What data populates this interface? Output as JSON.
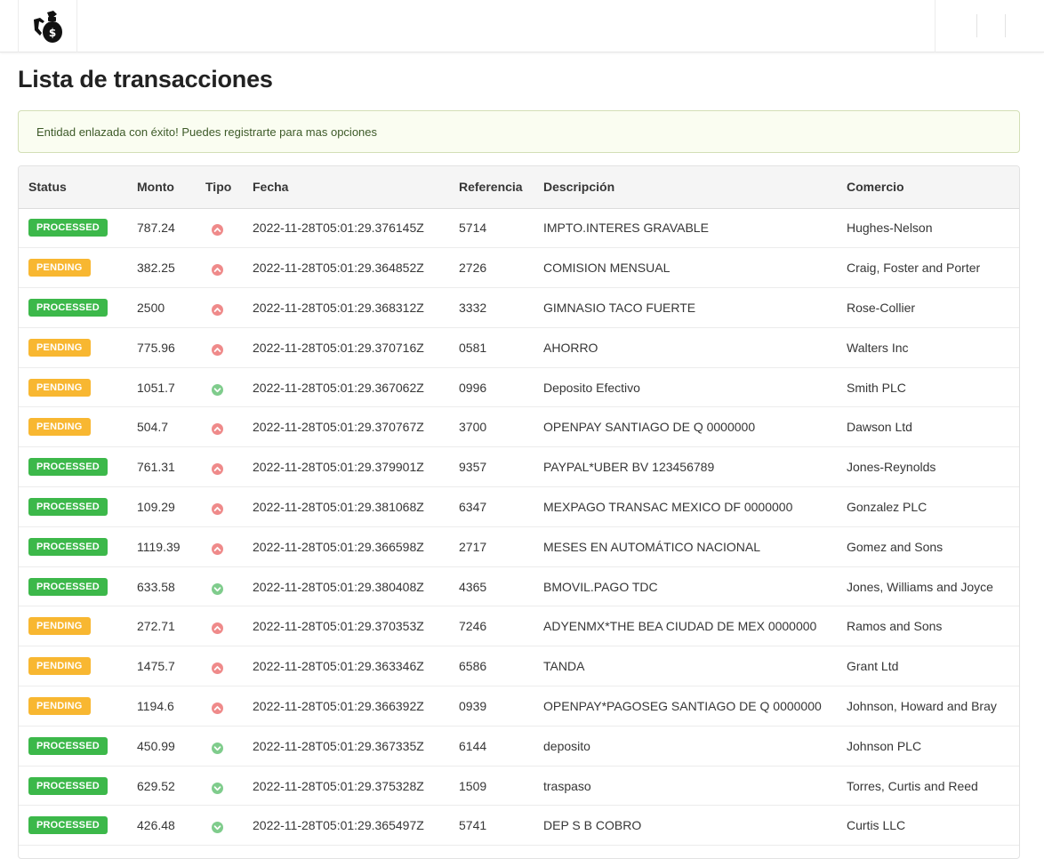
{
  "page": {
    "title": "Lista de transacciones"
  },
  "alert": {
    "text": "Entidad enlazada con éxito! Puedes registrarte para mas opciones"
  },
  "header": {
    "logo_icon": "money-bag-hand-icon"
  },
  "colors": {
    "processed": "#3cb84a",
    "pending": "#f8b731",
    "up_arrow": "#ef8a8a",
    "down_arrow": "#7fcc8c"
  },
  "table": {
    "columns": [
      "Status",
      "Monto",
      "Tipo",
      "Fecha",
      "Referencia",
      "Descripción",
      "Comercio"
    ],
    "rows": [
      {
        "status": "PROCESSED",
        "monto": "787.24",
        "tipo": "up",
        "fecha": "2022-11-28T05:01:29.376145Z",
        "referencia": "5714",
        "descripcion": "IMPTO.INTERES GRAVABLE",
        "comercio": "Hughes-Nelson"
      },
      {
        "status": "PENDING",
        "monto": "382.25",
        "tipo": "up",
        "fecha": "2022-11-28T05:01:29.364852Z",
        "referencia": "2726",
        "descripcion": "COMISION MENSUAL",
        "comercio": "Craig, Foster and Porter"
      },
      {
        "status": "PROCESSED",
        "monto": "2500",
        "tipo": "up",
        "fecha": "2022-11-28T05:01:29.368312Z",
        "referencia": "3332",
        "descripcion": "GIMNASIO TACO FUERTE",
        "comercio": "Rose-Collier"
      },
      {
        "status": "PENDING",
        "monto": "775.96",
        "tipo": "up",
        "fecha": "2022-11-28T05:01:29.370716Z",
        "referencia": "0581",
        "descripcion": "AHORRO",
        "comercio": "Walters Inc"
      },
      {
        "status": "PENDING",
        "monto": "1051.7",
        "tipo": "down",
        "fecha": "2022-11-28T05:01:29.367062Z",
        "referencia": "0996",
        "descripcion": "Deposito Efectivo",
        "comercio": "Smith PLC"
      },
      {
        "status": "PENDING",
        "monto": "504.7",
        "tipo": "up",
        "fecha": "2022-11-28T05:01:29.370767Z",
        "referencia": "3700",
        "descripcion": "OPENPAY SANTIAGO DE Q 0000000",
        "comercio": "Dawson Ltd"
      },
      {
        "status": "PROCESSED",
        "monto": "761.31",
        "tipo": "up",
        "fecha": "2022-11-28T05:01:29.379901Z",
        "referencia": "9357",
        "descripcion": "PAYPAL*UBER BV 123456789",
        "comercio": "Jones-Reynolds"
      },
      {
        "status": "PROCESSED",
        "monto": "109.29",
        "tipo": "up",
        "fecha": "2022-11-28T05:01:29.381068Z",
        "referencia": "6347",
        "descripcion": "MEXPAGO TRANSAC MEXICO DF 0000000",
        "comercio": "Gonzalez PLC"
      },
      {
        "status": "PROCESSED",
        "monto": "1119.39",
        "tipo": "up",
        "fecha": "2022-11-28T05:01:29.366598Z",
        "referencia": "2717",
        "descripcion": "MESES EN AUTOMÁTICO NACIONAL",
        "comercio": "Gomez and Sons"
      },
      {
        "status": "PROCESSED",
        "monto": "633.58",
        "tipo": "down",
        "fecha": "2022-11-28T05:01:29.380408Z",
        "referencia": "4365",
        "descripcion": "BMOVIL.PAGO TDC",
        "comercio": "Jones, Williams and Joyce"
      },
      {
        "status": "PENDING",
        "monto": "272.71",
        "tipo": "up",
        "fecha": "2022-11-28T05:01:29.370353Z",
        "referencia": "7246",
        "descripcion": "ADYENMX*THE BEA CIUDAD DE MEX 0000000",
        "comercio": "Ramos and Sons"
      },
      {
        "status": "PENDING",
        "monto": "1475.7",
        "tipo": "up",
        "fecha": "2022-11-28T05:01:29.363346Z",
        "referencia": "6586",
        "descripcion": "TANDA",
        "comercio": "Grant Ltd"
      },
      {
        "status": "PENDING",
        "monto": "1194.6",
        "tipo": "up",
        "fecha": "2022-11-28T05:01:29.366392Z",
        "referencia": "0939",
        "descripcion": "OPENPAY*PAGOSEG SANTIAGO DE Q 0000000",
        "comercio": "Johnson, Howard and Bray"
      },
      {
        "status": "PROCESSED",
        "monto": "450.99",
        "tipo": "down",
        "fecha": "2022-11-28T05:01:29.367335Z",
        "referencia": "6144",
        "descripcion": "deposito",
        "comercio": "Johnson PLC"
      },
      {
        "status": "PROCESSED",
        "monto": "629.52",
        "tipo": "down",
        "fecha": "2022-11-28T05:01:29.375328Z",
        "referencia": "1509",
        "descripcion": "traspaso",
        "comercio": "Torres, Curtis and Reed"
      },
      {
        "status": "PROCESSED",
        "monto": "426.48",
        "tipo": "down",
        "fecha": "2022-11-28T05:01:29.365497Z",
        "referencia": "5741",
        "descripcion": "DEP S B COBRO",
        "comercio": "Curtis LLC"
      }
    ]
  }
}
